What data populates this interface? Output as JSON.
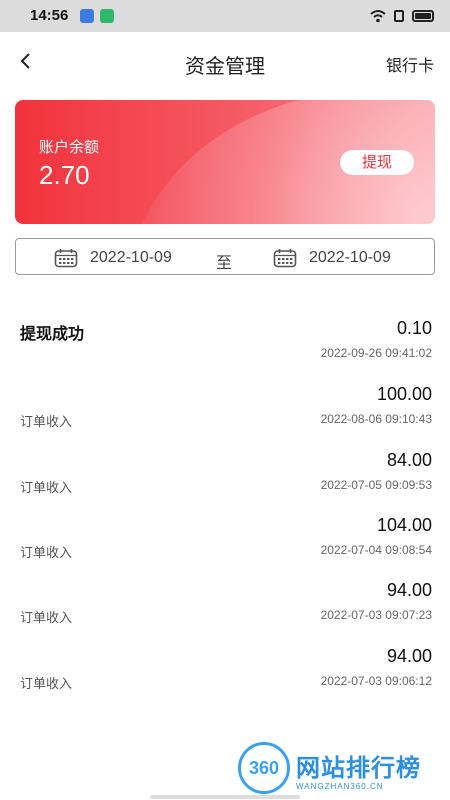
{
  "status_bar": {
    "time": "14:56"
  },
  "nav": {
    "title": "资金管理",
    "right_link": "银行卡"
  },
  "balance": {
    "label": "账户余额",
    "value": "2.70",
    "withdraw_label": "提现"
  },
  "date_filter": {
    "start": "2022-10-09",
    "separator": "至",
    "end": "2022-10-09"
  },
  "records": [
    {
      "title": "提现成功",
      "type": "",
      "amount": "0.10",
      "time": "2022-09-26 09:41:02"
    },
    {
      "title": "",
      "type": "订单收入",
      "amount": "100.00",
      "time": "2022-08-06 09:10:43"
    },
    {
      "title": "",
      "type": "订单收入",
      "amount": "84.00",
      "time": "2022-07-05 09:09:53"
    },
    {
      "title": "",
      "type": "订单收入",
      "amount": "104.00",
      "time": "2022-07-04 09:08:54"
    },
    {
      "title": "",
      "type": "订单收入",
      "amount": "94.00",
      "time": "2022-07-03 09:07:23"
    },
    {
      "title": "",
      "type": "订单收入",
      "amount": "94.00",
      "time": "2022-07-03 09:06:12"
    }
  ],
  "watermark": {
    "logo": "360",
    "text": "网站排行榜",
    "sub": "WANGZHAN360.CN"
  },
  "colors": {
    "accent": "#f2323c",
    "watermark": "#2d8fe0"
  }
}
